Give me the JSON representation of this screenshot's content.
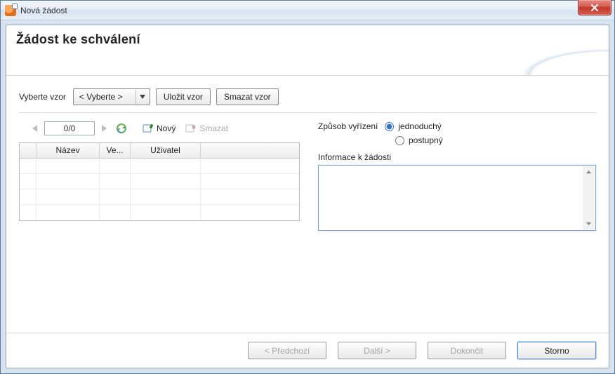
{
  "window": {
    "title": "Nová žádost"
  },
  "header": {
    "title": "Žádost ke schválení"
  },
  "vzor": {
    "label": "Vyberte vzor",
    "selected": "< Vyberte >",
    "save_btn": "Uložit vzor",
    "delete_btn": "Smazat vzor"
  },
  "navigator": {
    "page": "0/0",
    "new_btn": "Nový",
    "delete_btn": "Smazat"
  },
  "grid": {
    "cols": {
      "c1": "Název",
      "c2": "Ve...",
      "c3": "Uživatel",
      "c4": ""
    }
  },
  "right": {
    "zpusob_label": "Způsob vyřízení",
    "opt_jednoduchy": "jednoduchý",
    "opt_postupny": "postupný",
    "info_label": "Informace k žádosti",
    "info_value": ""
  },
  "footer": {
    "prev": "< Předchozí",
    "next": "Další >",
    "finish": "Dokončit",
    "cancel": "Storno"
  }
}
